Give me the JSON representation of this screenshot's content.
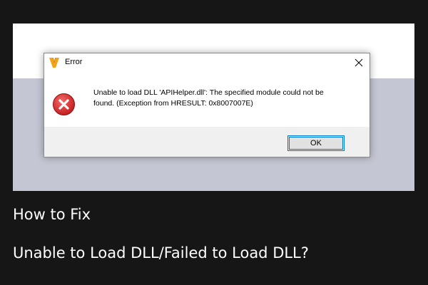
{
  "dialog": {
    "title": "Error",
    "message_line1": "Unable to load DLL 'APIHelper.dll': The specified module could not be",
    "message_line2": "found. (Exception from HRESULT: 0x8007007E)",
    "ok_label": "OK",
    "icons": {
      "app": "app-logo-icon",
      "close": "close-icon",
      "error": "error-icon"
    },
    "colors": {
      "error_red": "#d42a2a",
      "focus_blue": "#0078d7"
    }
  },
  "caption": {
    "line1": "How to Fix",
    "line2": "Unable to Load DLL/Failed to Load DLL?"
  }
}
